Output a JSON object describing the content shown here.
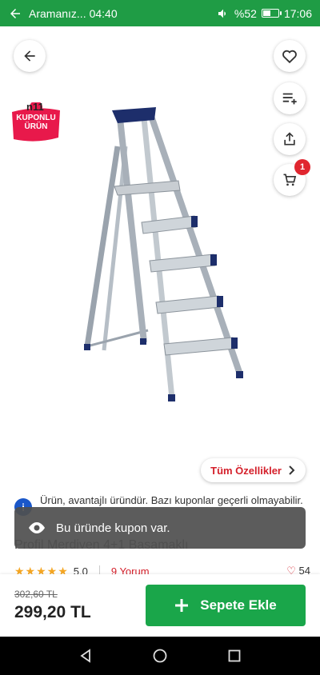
{
  "status_bar": {
    "back_label": "Aramanız...",
    "left_time": "04:40",
    "battery_percent": "%52",
    "battery_level": 0.52,
    "clock": "17:06"
  },
  "header": {
    "cart_count": "1"
  },
  "coupon_badge": {
    "brand": "n11",
    "line1": "KUPONLU",
    "line2": "ÜRÜN"
  },
  "features_button": {
    "label": "Tüm Özellikler"
  },
  "info": {
    "icon_text": "i",
    "message": "Ürün, avantajlı üründür. Bazı kuponlar geçerli olmayabilir."
  },
  "product": {
    "title": "Profil Merdiven 4+1 Basamaklı",
    "stars": "★★★★★",
    "rating": "5.0",
    "reviews": "9 Yorum",
    "likes": "54"
  },
  "toast": {
    "message": "Bu üründe kupon var."
  },
  "pricing": {
    "old_price": "302,60 TL",
    "new_price": "299,20 TL",
    "add_to_cart": "Sepete Ekle"
  },
  "colors": {
    "status_green": "#1f9c45",
    "brand_red": "#d4202b",
    "cart_green": "#1aa64a",
    "info_blue": "#1a57c9"
  },
  "icons": {
    "back": "arrow-left-icon",
    "favorite": "heart-icon",
    "add_list": "playlist-add-icon",
    "share": "share-icon",
    "cart": "cart-icon",
    "eye": "eye-icon"
  }
}
